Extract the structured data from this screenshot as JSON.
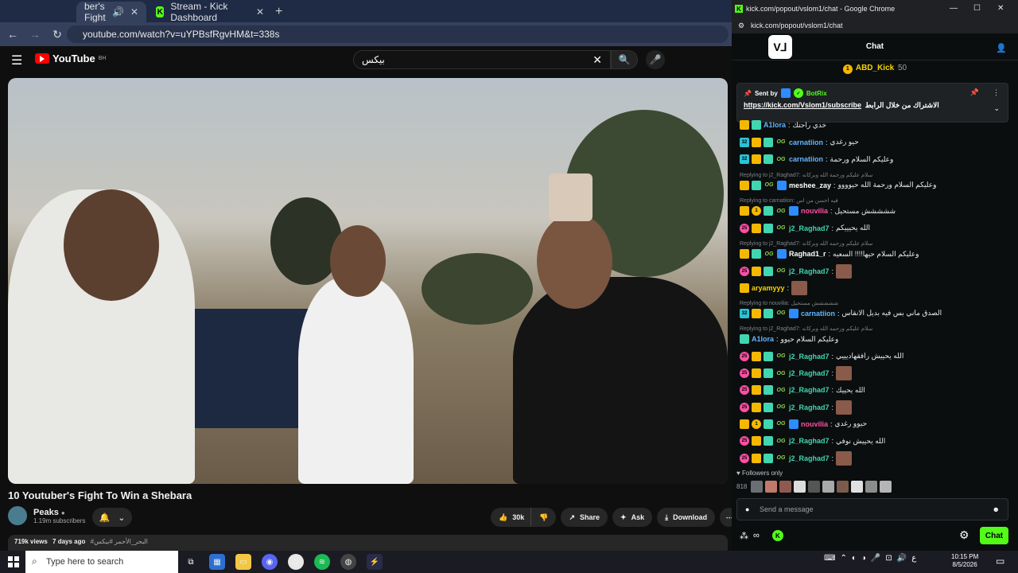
{
  "browser_left": {
    "tabs": [
      {
        "label": "ber's Fight",
        "active": true
      },
      {
        "label": "Stream - Kick Dashboard",
        "active": false
      }
    ],
    "url": "youtube.com/watch?v=uYPBsfRgvHM&t=338s"
  },
  "youtube": {
    "logo": "YouTube",
    "region": "BH",
    "search_value": "بيكس",
    "video_title": "10 Youtuber's Fight To Win a Shebara",
    "channel_name": "Peaks",
    "subscribers": "1.19m subscribers",
    "likes": "30k",
    "share": "Share",
    "ask": "Ask",
    "download": "Download",
    "views": "719k views",
    "uploaded": "7 days ago",
    "tags": "#البحر_الأحمر #بيكس"
  },
  "chat_window": {
    "title": "kick.com/popout/vslom1/chat - Google Chrome",
    "url": "kick.com/popout/vslom1/chat",
    "header": "Chat",
    "top_gifter": {
      "name": "ABD_Kick",
      "count": "50",
      "rank": "1"
    },
    "pinned": {
      "sent_by": "Sent by",
      "bot_name": "BotRix",
      "link": "https://kick.com/Vslom1/subscribe",
      "text": "الاشتراك من خلال الرابط"
    },
    "messages": [
      {
        "type": "msg",
        "badges": [
          "crown",
          "gift"
        ],
        "user": "A1lora",
        "color": "#5fb6ff",
        "text": "خدي راحتك"
      },
      {
        "type": "msg",
        "badges": [
          "sub",
          "crown",
          "gift",
          "og"
        ],
        "user": "carnatiion",
        "color": "#5fb6ff",
        "text": "حيو رغدي",
        "sub": "32"
      },
      {
        "type": "msg",
        "badges": [
          "sub",
          "crown",
          "gift",
          "og"
        ],
        "user": "carnatiion",
        "color": "#5fb6ff",
        "text": "وعليكم السلام ورحمة",
        "sub": "32"
      },
      {
        "type": "reply",
        "text": "Replying to j2_Raghad7: سلام عليكم ورحمة الله وبركاته"
      },
      {
        "type": "msg",
        "badges": [
          "crown",
          "gift",
          "og",
          "blue"
        ],
        "user": "meshee_zay",
        "color": "#ffffff",
        "text": "وعليكم السلام ورحمة الله حيوووو"
      },
      {
        "type": "reply",
        "text": "Replying to carnatiion: فيه احسن من اس"
      },
      {
        "type": "msg",
        "badges": [],
        "user": "",
        "color": "#ffffff",
        "text": "ششششش مستحيل"
      },
      {
        "type": "msg",
        "badges": [
          "crown",
          "gold",
          "gift",
          "og",
          "blue"
        ],
        "user": "nouvilia",
        "color": "#ff4fa3",
        "text": "ششششش مستحيل"
      },
      {
        "type": "msg",
        "badges": [
          "pink",
          "crown",
          "gift",
          "og"
        ],
        "user": "j2_Raghad7",
        "color": "#40d6b0",
        "text": "الله يحيييكم"
      },
      {
        "type": "reply",
        "text": "Replying to j2_Raghad7: سلام عليكم ورحمه الله وبركاته"
      },
      {
        "type": "msg",
        "badges": [
          "crown",
          "gift",
          "og",
          "blue"
        ],
        "user": "Raghad1_r",
        "color": "#ffffff",
        "text": "وعليكم السلام حيها!!!! السعيه"
      },
      {
        "type": "msg",
        "badges": [
          "pink",
          "crown",
          "gift",
          "og"
        ],
        "user": "j2_Raghad7",
        "color": "#40d6b0",
        "text": "",
        "emote": true
      },
      {
        "type": "msg",
        "badges": [
          "crown"
        ],
        "user": "aryamyyy",
        "color": "#f5d400",
        "text": "",
        "emote": true
      },
      {
        "type": "reply",
        "text": "Replying to nouvilia: ششششش مستحيل"
      },
      {
        "type": "msg",
        "badges": [
          "sub",
          "crown",
          "gift",
          "og",
          "blue"
        ],
        "user": "carnatiion",
        "color": "#5fb6ff",
        "text": "الصدق ماني بس فيه بديل الانقاس",
        "sub": "32"
      },
      {
        "type": "reply",
        "text": "Replying to j2_Raghad7: سلام عليكم ورحمه الله وبركاته"
      },
      {
        "type": "msg",
        "badges": [
          "gift"
        ],
        "user": "A1lora",
        "color": "#5fb6ff",
        "text": "وعليكم السلام حيوو"
      },
      {
        "type": "msg",
        "badges": [
          "pink",
          "crown",
          "gift",
          "og"
        ],
        "user": "j2_Raghad7",
        "color": "#40d6b0",
        "text": "الله يحييش رافقهاديييي"
      },
      {
        "type": "msg",
        "badges": [
          "pink",
          "crown",
          "gift",
          "og"
        ],
        "user": "j2_Raghad7",
        "color": "#40d6b0",
        "text": "",
        "emote": true
      },
      {
        "type": "msg",
        "badges": [
          "pink",
          "crown",
          "gift",
          "og"
        ],
        "user": "j2_Raghad7",
        "color": "#40d6b0",
        "text": "الله يحييك"
      },
      {
        "type": "msg",
        "badges": [
          "pink",
          "crown",
          "gift",
          "og"
        ],
        "user": "j2_Raghad7",
        "color": "#40d6b0",
        "text": "",
        "emote": true
      },
      {
        "type": "msg",
        "badges": [
          "crown",
          "gold",
          "gift",
          "og",
          "blue"
        ],
        "user": "nouvilia",
        "color": "#ff4fa3",
        "text": "حيوو رغدي"
      },
      {
        "type": "msg",
        "badges": [
          "pink",
          "crown",
          "gift",
          "og"
        ],
        "user": "j2_Raghad7",
        "color": "#40d6b0",
        "text": "الله يحييش نوفي"
      },
      {
        "type": "msg",
        "badges": [
          "pink",
          "crown",
          "gift",
          "og"
        ],
        "user": "j2_Raghad7",
        "color": "#40d6b0",
        "text": "",
        "emote": true
      }
    ],
    "followers_only": "Followers only",
    "viewer_count": "818",
    "send_placeholder": "Send a message",
    "chat_button": "Chat"
  },
  "taskbar": {
    "search_placeholder": "Type here to search",
    "time": "10:15 PM",
    "date": "8/5/2026",
    "lang": "ع"
  }
}
